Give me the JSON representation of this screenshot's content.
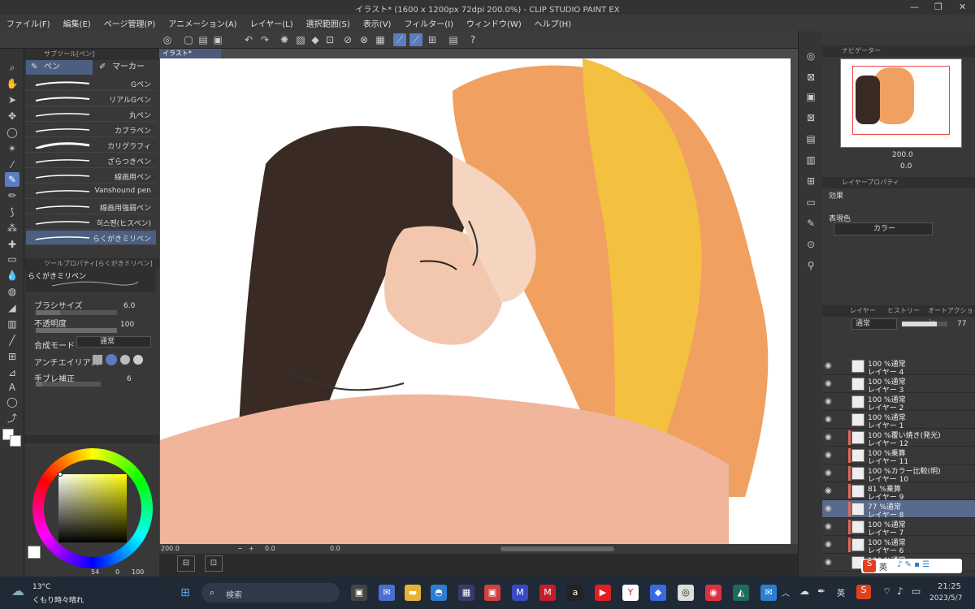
{
  "titlebar": {
    "title": "イラスト* (1600 x 1200px 72dpi 200.0%) - CLIP STUDIO PAINT EX"
  },
  "menu": [
    "ファイル(F)",
    "編集(E)",
    "ページ管理(P)",
    "アニメーション(A)",
    "レイヤー(L)",
    "選択範囲(S)",
    "表示(V)",
    "フィルター(I)",
    "ウィンドウ(W)",
    "ヘルプ(H)"
  ],
  "subtool": {
    "header": "サブツール[ペン]",
    "tabs": [
      "ペン",
      "マーカー"
    ],
    "brushes": [
      "Gペン",
      "リアルGペン",
      "丸ペン",
      "カブラペン",
      "カリグラフィ",
      "ざらつきペン",
      "線画用ペン",
      "Vanshound pen",
      "線画用強弱ペン",
      "히스펜(ヒスペン)",
      "らくがきミリペン"
    ]
  },
  "toolprop": {
    "header": "ツールプロパティ[らくがきミリペン]",
    "name": "らくがきミリペン",
    "brush_size_label": "ブラシサイズ",
    "brush_size": "6.0",
    "opacity_label": "不透明度",
    "opacity": "100",
    "blend_label": "合成モード",
    "blend": "通常",
    "aa_label": "アンチエイリアス",
    "stab_label": "手ブレ補正",
    "stab": "6"
  },
  "color": {
    "h": "54",
    "s": "0",
    "v": "100"
  },
  "document": {
    "tab": "イラスト*",
    "zoom": "200.0",
    "angle": "0.0",
    "pos": "0.0"
  },
  "navigator": {
    "header": "ナビゲーター",
    "zoom": "200.0",
    "angle": "0.0"
  },
  "layerprop": {
    "header": "レイヤープロパティ",
    "effect": "効果",
    "color_label": "表現色",
    "color_value": "カラー"
  },
  "layers_panel": {
    "tabs": [
      "レイヤー",
      "ヒストリー",
      "オートアクション"
    ],
    "blend": "通常",
    "opacity": "77",
    "items": [
      {
        "l1": "100 %通常",
        "l2": "レイヤー 4",
        "color": ""
      },
      {
        "l1": "100 %通常",
        "l2": "レイヤー 3",
        "color": ""
      },
      {
        "l1": "100 %通常",
        "l2": "レイヤー 2",
        "color": ""
      },
      {
        "l1": "100 %通常",
        "l2": "レイヤー 1",
        "color": ""
      },
      {
        "l1": "100 %覆い焼き(発光)",
        "l2": "レイヤー 12",
        "color": "#e06a5a"
      },
      {
        "l1": "100 %乗算",
        "l2": "レイヤー 11",
        "color": "#e06a5a"
      },
      {
        "l1": "100 %カラー比較(明)",
        "l2": "レイヤー 10",
        "color": "#e06a5a"
      },
      {
        "l1": "81 %乗算",
        "l2": "レイヤー 9",
        "color": "#e06a5a"
      },
      {
        "l1": "77 %通常",
        "l2": "レイヤー 8",
        "color": "#e06a5a"
      },
      {
        "l1": "100 %通常",
        "l2": "レイヤー 7",
        "color": "#e06a5a"
      },
      {
        "l1": "100 %通常",
        "l2": "レイヤー 6",
        "color": "#e06a5a"
      },
      {
        "l1": "100 %通常",
        "l2": "",
        "color": ""
      }
    ]
  },
  "taskbar": {
    "weather_temp": "13°C",
    "weather_text": "くもり時々晴れ",
    "search": "検索",
    "time": "21:25",
    "date": "2023/5/7",
    "ime": "英",
    "ime_tray": "英"
  }
}
